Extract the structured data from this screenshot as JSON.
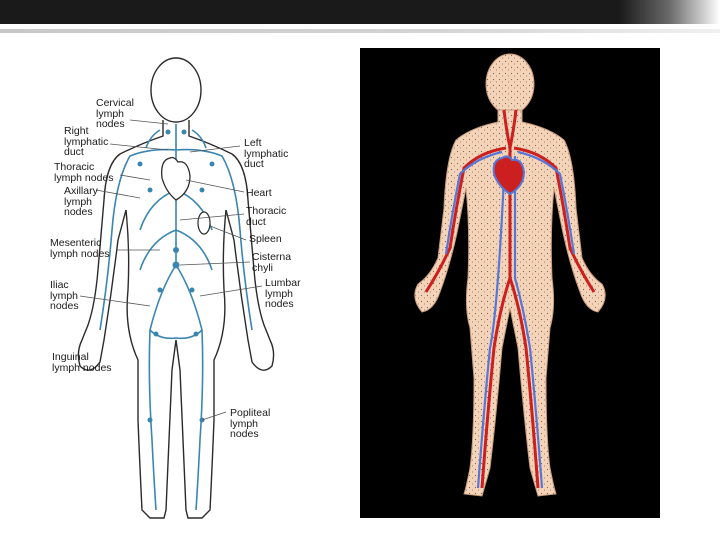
{
  "colors": {
    "lymph_vessels": "#3a86b0",
    "body_outline": "#2a2a2a",
    "skin": "#f4d3b8",
    "arteries": "#cc1f1f",
    "veins": "#5677d8",
    "background_panel": "#000000"
  },
  "lymph_diagram": {
    "labels": {
      "cervical": "Cervical\nlymph\nnodes",
      "right_duct": "Right\nlymphatic\nduct",
      "thoracic_nodes": "Thoracic\nlymph nodes",
      "axillary": "Axillary\nlymph\nnodes",
      "mesenteric": "Mesenteric\nlymph nodes",
      "iliac": "Iliac\nlymph\nnodes",
      "inguinal": "Inguinal\nlymph nodes",
      "left_duct": "Left\nlymphatic\nduct",
      "heart": "Heart",
      "thoracic_duct": "Thoracic\nduct",
      "spleen": "Spleen",
      "cisterna": "Cisterna\nchyli",
      "lumbar": "Lumbar\nlymph\nnodes",
      "popliteal": "Popliteal\nlymph\nnodes"
    }
  }
}
